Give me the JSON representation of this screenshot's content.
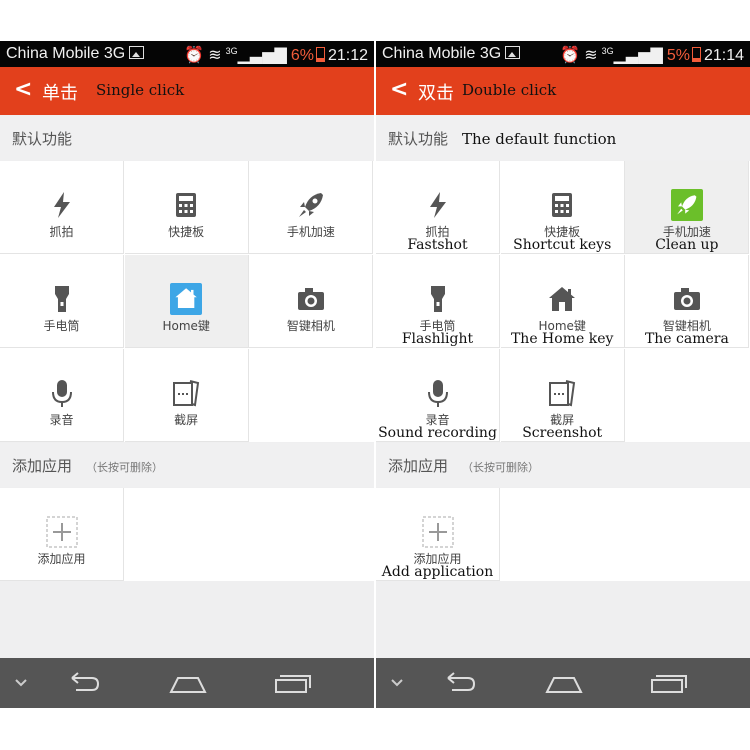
{
  "left": {
    "status": {
      "carrier": "China Mobile 3G",
      "network": "3G",
      "battery": "6%",
      "time": "21:12"
    },
    "header": {
      "title": "单击",
      "title_en": "Single click"
    },
    "section_default": {
      "title": "默认功能",
      "title_en": ""
    },
    "grid": [
      {
        "label": "抓拍",
        "label_en": "",
        "icon": "flash-icon"
      },
      {
        "label": "快捷板",
        "label_en": "",
        "icon": "calculator-icon"
      },
      {
        "label": "手机加速",
        "label_en": "",
        "icon": "rocket-icon"
      },
      {
        "label": "手电筒",
        "label_en": "",
        "icon": "flashlight-icon"
      },
      {
        "label": "Home键",
        "label_en": "",
        "icon": "home-icon",
        "selected": true
      },
      {
        "label": "智键相机",
        "label_en": "",
        "icon": "camera-icon"
      },
      {
        "label": "录音",
        "label_en": "",
        "icon": "microphone-icon"
      },
      {
        "label": "截屏",
        "label_en": "",
        "icon": "screenshot-icon"
      }
    ],
    "section_add": {
      "title": "添加应用",
      "hint": "（长按可删除）"
    },
    "add_app": {
      "label": "添加应用",
      "label_en": "",
      "icon": "plus-icon"
    }
  },
  "right": {
    "status": {
      "carrier": "China Mobile 3G",
      "network": "3G",
      "battery": "5%",
      "time": "21:14"
    },
    "header": {
      "title": "双击",
      "title_en": "Double click"
    },
    "section_default": {
      "title": "默认功能",
      "title_en": "The default function"
    },
    "grid": [
      {
        "label": "抓拍",
        "label_en": "Fastshot",
        "icon": "flash-icon"
      },
      {
        "label": "快捷板",
        "label_en": "Shortcut keys",
        "icon": "calculator-icon"
      },
      {
        "label": "手机加速",
        "label_en": "Clean up",
        "icon": "rocket-icon",
        "selected": true
      },
      {
        "label": "手电筒",
        "label_en": "Flashlight",
        "icon": "flashlight-icon"
      },
      {
        "label": "Home键",
        "label_en": "The Home key",
        "icon": "home-icon"
      },
      {
        "label": "智键相机",
        "label_en": "The camera",
        "icon": "camera-icon"
      },
      {
        "label": "录音",
        "label_en": "Sound recording",
        "icon": "microphone-icon"
      },
      {
        "label": "截屏",
        "label_en": "Screenshot",
        "icon": "screenshot-icon"
      }
    ],
    "section_add": {
      "title": "添加应用",
      "hint": "（长按可删除）"
    },
    "add_app": {
      "label": "添加应用",
      "label_en": "Add application",
      "icon": "plus-icon"
    }
  },
  "colors": {
    "accent": "#e2401c",
    "selected_icon": "#3da6e6",
    "selected_green": "#6bbf2a",
    "icon_gray": "#555555"
  }
}
